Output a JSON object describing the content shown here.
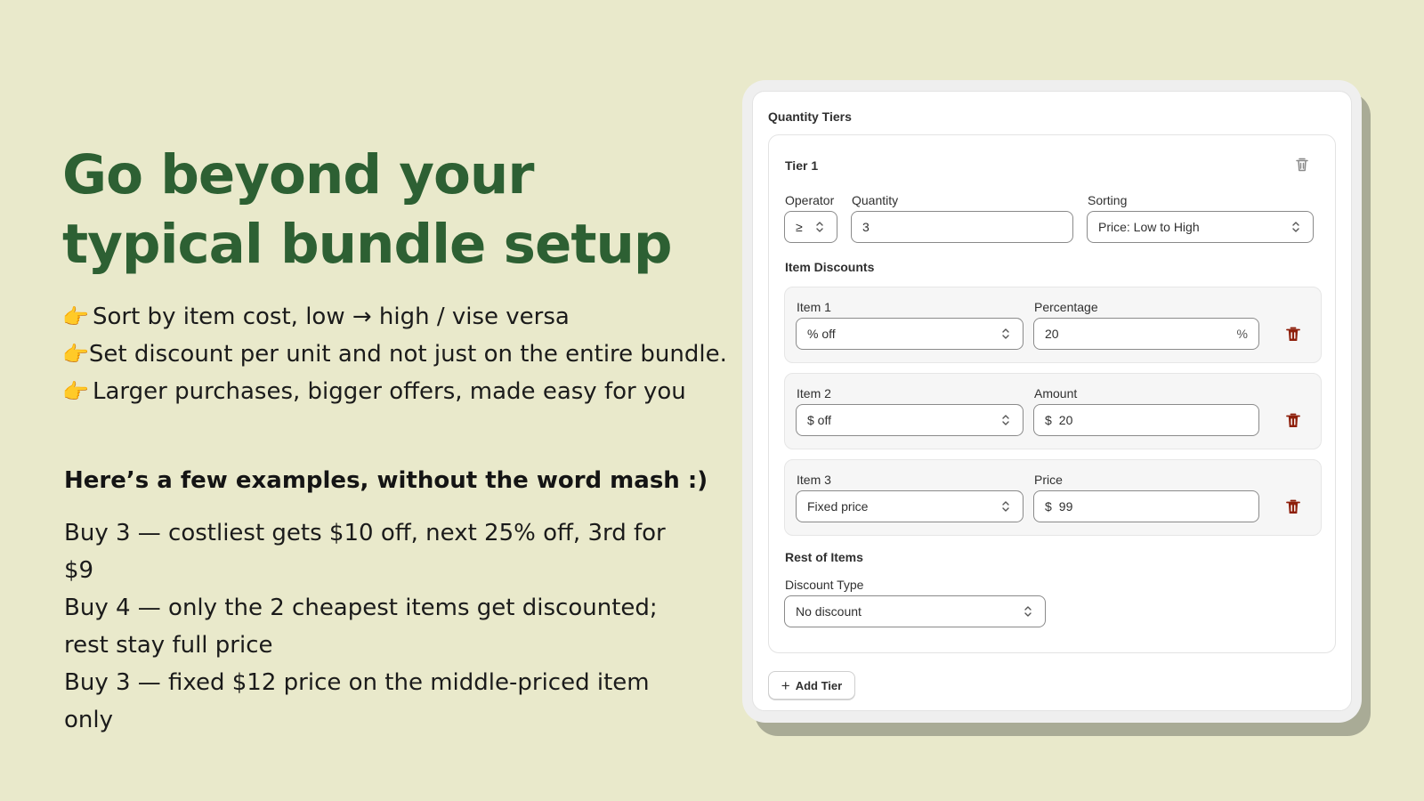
{
  "headline": {
    "line1": "Go beyond your",
    "line2": "typical bundle setup"
  },
  "bullets": [
    {
      "icon": "pointing-hand-icon",
      "glyph": "👉",
      "text": "Sort by item cost, low → high / vise versa"
    },
    {
      "icon": "pointing-hand-icon",
      "glyph": "👉",
      "text": "Set discount per unit and not just on the entire bundle."
    },
    {
      "icon": "pointing-hand-icon",
      "glyph": "👉",
      "text": "Larger purchases, bigger offers, made easy for you"
    }
  ],
  "examples": {
    "title": "Here’s a few examples, without the word mash :)",
    "items": [
      "Buy 3 — costliest gets $10 off, next 25% off, 3rd for $9",
      "Buy 4 — only the 2 cheapest items get discounted; rest stay full price",
      "Buy 3 — fixed $12 price on the middle-priced item only"
    ]
  },
  "card": {
    "title": "Quantity Tiers",
    "tier": {
      "title": "Tier 1",
      "operator": {
        "label": "Operator",
        "value": "≥"
      },
      "quantity": {
        "label": "Quantity",
        "value": "3"
      },
      "sorting": {
        "label": "Sorting",
        "value": "Price: Low to High"
      },
      "item_discounts_title": "Item Discounts",
      "items": [
        {
          "label": "Item 1",
          "type": "% off",
          "value_label": "Percentage",
          "value": "20",
          "prefix": "",
          "suffix": "%"
        },
        {
          "label": "Item 2",
          "type": "$ off",
          "value_label": "Amount",
          "value": "20",
          "prefix": "$",
          "suffix": ""
        },
        {
          "label": "Item 3",
          "type": "Fixed price",
          "value_label": "Price",
          "value": "99",
          "prefix": "$",
          "suffix": ""
        }
      ],
      "rest_title": "Rest of Items",
      "discount_type": {
        "label": "Discount Type",
        "value": "No discount"
      }
    },
    "add_tier_label": "Add Tier"
  },
  "colors": {
    "background": "#e9e9cb",
    "headline": "#2d6033",
    "delete_red": "#8e1f0b",
    "delete_grey": "#8a8a8a"
  }
}
